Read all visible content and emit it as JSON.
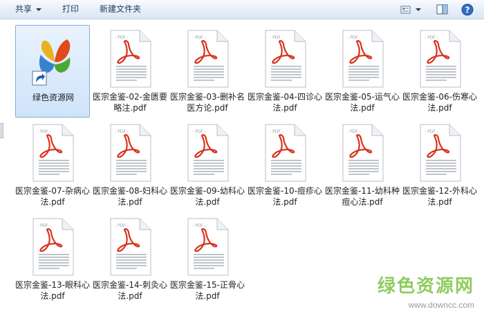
{
  "toolbar": {
    "share_label": "共享",
    "print_label": "打印",
    "new_folder_label": "新建文件夹",
    "view_icon": "view-icon",
    "preview_pane_icon": "preview-pane-icon",
    "help_icon": "help-icon"
  },
  "files": [
    {
      "name": "绿色资源网",
      "type": "shortcut",
      "selected": true
    },
    {
      "name": "医宗金鉴-02-金匮要略注.pdf",
      "type": "pdf"
    },
    {
      "name": "医宗金鉴-03-删补名医方论.pdf",
      "type": "pdf"
    },
    {
      "name": "医宗金鉴-04-四诊心法.pdf",
      "type": "pdf"
    },
    {
      "name": "医宗金鉴-05-运气心法.pdf",
      "type": "pdf"
    },
    {
      "name": "医宗金鉴-06-伤寒心法.pdf",
      "type": "pdf"
    },
    {
      "name": "医宗金鉴-07-杂病心法.pdf",
      "type": "pdf"
    },
    {
      "name": "医宗金鉴-08-妇科心法.pdf",
      "type": "pdf"
    },
    {
      "name": "医宗金鉴-09-幼科心法.pdf",
      "type": "pdf"
    },
    {
      "name": "医宗金鉴-10-痘疹心法.pdf",
      "type": "pdf"
    },
    {
      "name": "医宗金鉴-11-幼科种痘心法.pdf",
      "type": "pdf"
    },
    {
      "name": "医宗金鉴-12-外科心法.pdf",
      "type": "pdf"
    },
    {
      "name": "医宗金鉴-13-眼科心法.pdf",
      "type": "pdf"
    },
    {
      "name": "医宗金鉴-14-刺灸心法.pdf",
      "type": "pdf"
    },
    {
      "name": "医宗金鉴-15-正骨心法.pdf",
      "type": "pdf"
    }
  ],
  "pdf_badge": "PDF",
  "watermark": {
    "text": "绿色资源网",
    "url": "www.downcc.com"
  },
  "colors": {
    "pdf_red": "#d6331e",
    "selection": "#cfe3fa",
    "watermark_green": "#7cc444"
  }
}
